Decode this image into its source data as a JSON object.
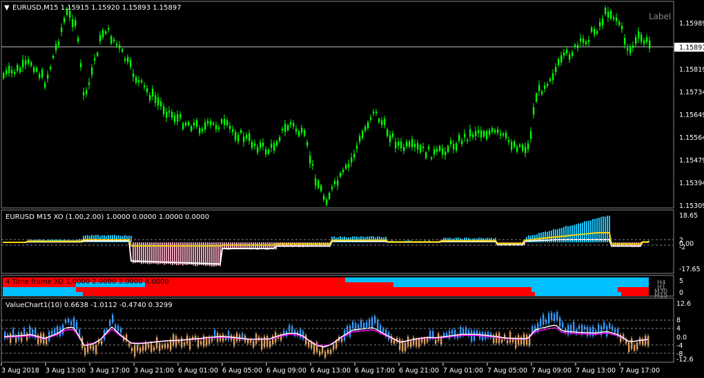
{
  "main_chart": {
    "header": "EURUSD,M15  1.15915 1.15920 1.15893 1.15897",
    "object_label": "Label",
    "current_price": "1.15897",
    "price_ticks": [
      "1.15989",
      "1.15819",
      "1.15734",
      "1.15649",
      "1.15564",
      "1.15479",
      "1.15394",
      "1.15309"
    ],
    "colors": {
      "background": "#000000",
      "candles": "#00ff00",
      "grid": "#ffffff"
    }
  },
  "xo_panel": {
    "header": "EURUSD M15 XO (1.00,2.00) 1.0000 0.0000 1.0000 0.0000",
    "ticks": [
      "18.65",
      "2",
      "0.00",
      "-2",
      "-17.65"
    ],
    "colors": {
      "positive": "#1ec8ff",
      "negative": "#e8a0b8",
      "line_yellow": "#ffd700",
      "line_white": "#ffffff"
    }
  },
  "tf_panel": {
    "header": "4 Time frame XO 1.0000 2.0000 3.0000 4.0000",
    "ticks": [
      "5",
      "0"
    ],
    "row_labels": [
      "H4",
      "H1",
      "M30",
      "M15"
    ],
    "colors": {
      "red": "#ff0000",
      "blue": "#00bfff"
    }
  },
  "value_chart": {
    "header": "ValueChart1(10) 0.6638 -1.0112 -0.4740 0.3299",
    "ticks": [
      "12.6",
      "8",
      "4",
      "0.0",
      "-4",
      "-8",
      "-12.6"
    ],
    "colors": {
      "up": "#3399ff",
      "down": "#e0a060",
      "line_white": "#ffffff",
      "line_magenta": "#ff00ff"
    }
  },
  "time_axis": {
    "labels": [
      "3 Aug 2018",
      "3 Aug 13:00",
      "3 Aug 17:00",
      "3 Aug 21:00",
      "6 Aug 01:00",
      "6 Aug 05:00",
      "6 Aug 09:00",
      "6 Aug 13:00",
      "6 Aug 17:00",
      "6 Aug 21:00",
      "7 Aug 01:00",
      "7 Aug 05:00",
      "7 Aug 09:00",
      "7 Aug 13:00",
      "7 Aug 17:00"
    ]
  }
}
